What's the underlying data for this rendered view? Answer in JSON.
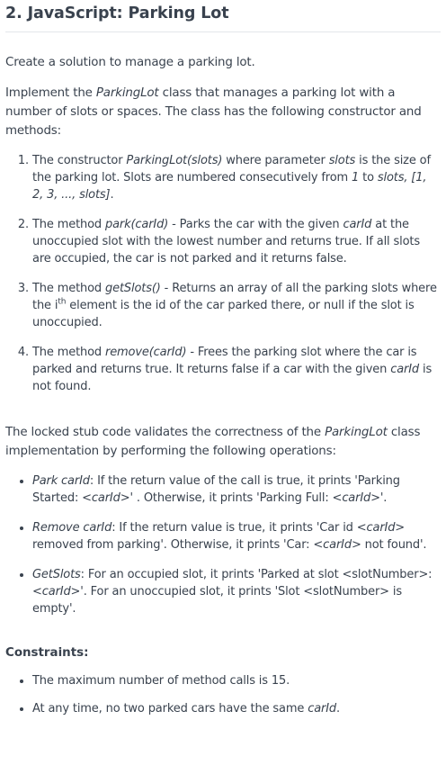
{
  "title": "2. JavaScript: Parking Lot",
  "intro": "Create a solution to manage a parking lot.",
  "impl": {
    "a": "Implement the ",
    "cls": "ParkingLot",
    "b": " class that manages a parking lot with a number of slots or spaces. The class has the following constructor and methods:"
  },
  "methods": [
    {
      "a": "The constructor ",
      "sig": "ParkingLot(slots)",
      "b": " where parameter ",
      "param": "slots",
      "c": " is the size of the parking lot.  Slots are numbered consecutively from ",
      "one": "1",
      "d": " to ",
      "range": "slots, [1, 2, 3, ..., slots]",
      "e": "."
    },
    {
      "a": "The method ",
      "sig": "park(carId)",
      "b": " - Parks the car with the given ",
      "param": "carId",
      "c": " at the unoccupied slot with the lowest number and returns true. If all slots are occupied, the car is not parked and it returns false."
    },
    {
      "a": "The method ",
      "sig": "getSlots()",
      "b": " - Returns an array of all the parking slots where the i",
      "sup": "th",
      "c": " element is the id of the car parked there, or null if the slot is unoccupied."
    },
    {
      "a": "The method ",
      "sig": "remove(carId)",
      "b": " - Frees the parking slot where the car is parked and returns true. It returns false if a car with the given ",
      "param": "carId",
      "c": " is not found."
    }
  ],
  "locked": {
    "a": "The locked stub code validates the correctness of the ",
    "cls": "ParkingLot",
    "b": " class implementation by performing the following operations:"
  },
  "operations": [
    {
      "name": "Park carId",
      "a": ": If the return value of the call is true, it prints 'Parking Started: <",
      "v1": "carId",
      "b": ">' .  Otherwise,  it prints 'Parking Full: <",
      "v2": "carId",
      "c": ">'."
    },
    {
      "name": "Remove carId",
      "a": ": If the return value is true, it prints 'Car id <",
      "v1": "carId",
      "b": "> removed from parking'. Otherwise, it prints 'Car: <",
      "v2": "carId",
      "c": "> not found'."
    },
    {
      "name": "GetSlots",
      "a": ": For an occupied slot, it prints 'Parked at slot <slotNumber>: <",
      "v1": "carId",
      "b": ">'. For an unoccupied slot, it prints 'Slot <slotNumber> is empty'."
    }
  ],
  "constraints_title": "Constraints:",
  "constraints": [
    {
      "text": "The maximum number of method calls is 15."
    },
    {
      "a": "At any time, no two parked cars have the same ",
      "param": "carId",
      "b": "."
    }
  ]
}
